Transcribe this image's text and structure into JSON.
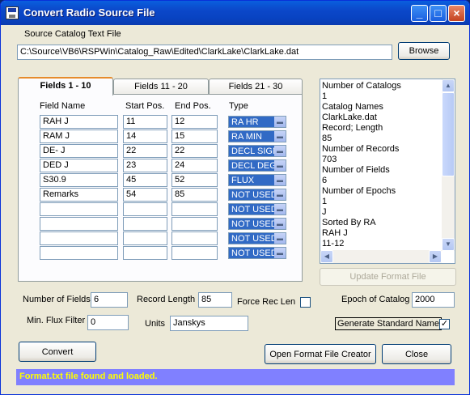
{
  "window": {
    "title": "Convert Radio Source File",
    "minimize": "_",
    "maximize": "□",
    "close": "×"
  },
  "source": {
    "label": "Source Catalog Text File",
    "path": "C:\\Source\\VB6\\RSPWin\\Catalog_Raw\\Edited\\ClarkLake\\ClarkLake.dat",
    "browse_label": "Browse"
  },
  "tabs": [
    {
      "label": "Fields 1 - 10",
      "active": true
    },
    {
      "label": "Fields 11 - 20",
      "active": false
    },
    {
      "label": "Fields 21 - 30",
      "active": false
    }
  ],
  "columns": {
    "name": "Field Name",
    "start": "Start Pos.",
    "end": "End Pos.",
    "type": "Type"
  },
  "rows": [
    {
      "name": "RAH J",
      "start": "11",
      "end": "12",
      "type": "RA HR"
    },
    {
      "name": "RAM J",
      "start": "14",
      "end": "15",
      "type": "RA MIN"
    },
    {
      "name": "DE- J",
      "start": "22",
      "end": "22",
      "type": "DECL SIGN"
    },
    {
      "name": "DED J",
      "start": "23",
      "end": "24",
      "type": "DECL DEG"
    },
    {
      "name": "S30.9",
      "start": "45",
      "end": "52",
      "type": "FLUX"
    },
    {
      "name": "Remarks",
      "start": "54",
      "end": "85",
      "type": "NOT USED"
    },
    {
      "name": "",
      "start": "",
      "end": "",
      "type": "NOT USED"
    },
    {
      "name": "",
      "start": "",
      "end": "",
      "type": "NOT USED"
    },
    {
      "name": "",
      "start": "",
      "end": "",
      "type": "NOT USED"
    },
    {
      "name": "",
      "start": "",
      "end": "",
      "type": "NOT USED"
    }
  ],
  "info_list": [
    "Number of Catalogs",
    "1",
    "Catalog Names",
    "ClarkLake.dat",
    "Record; Length",
    "85",
    "Number of Records",
    "703",
    "Number of Fields",
    "6",
    "Number of Epochs",
    "1",
    "J",
    "Sorted By RA",
    "RAH J",
    "11-12"
  ],
  "update_format_label": "Update Format File",
  "num_fields": {
    "label": "Number of Fields",
    "value": "6"
  },
  "record_length": {
    "label": "Record Length",
    "value": "85"
  },
  "force_rec_len": {
    "label": "Force Rec Len",
    "checked": ""
  },
  "epoch": {
    "label": "Epoch of Catalog",
    "value": "2000"
  },
  "min_flux": {
    "label": "Min. Flux Filter",
    "value": "0"
  },
  "units": {
    "label": "Units",
    "value": "Janskys"
  },
  "gen_std_name": {
    "label": "Generate Standard Name",
    "checked": "✓"
  },
  "buttons": {
    "convert": "Convert",
    "open_format": "Open Format File Creator",
    "close": "Close"
  },
  "status": "Format.txt file found and loaded."
}
